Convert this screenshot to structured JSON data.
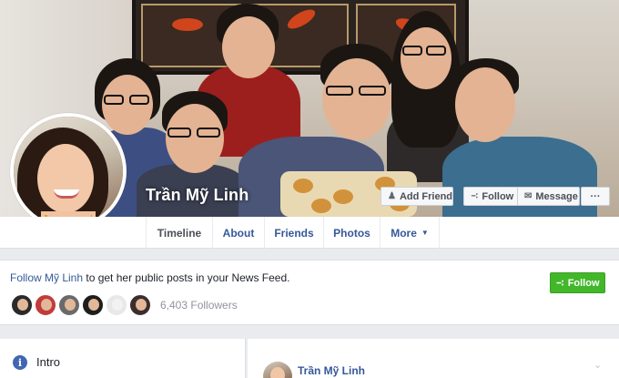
{
  "profile": {
    "name": "Trần Mỹ Linh"
  },
  "cover_actions": {
    "add_friend": "Add Friend",
    "follow": "Follow",
    "message": "Message",
    "more": "···"
  },
  "tabs": [
    {
      "label": "Timeline",
      "active": true
    },
    {
      "label": "About"
    },
    {
      "label": "Friends"
    },
    {
      "label": "Photos"
    },
    {
      "label": "More"
    }
  ],
  "follow_prompt": {
    "link_text": "Follow Mỹ Linh",
    "rest_text": " to get her public posts in your News Feed.",
    "button_label": "Follow",
    "followers_count": "6,403 Followers"
  },
  "intro": {
    "title": "Intro"
  },
  "post": {
    "author": "Trần Mỹ Linh"
  },
  "icons": {
    "add_friend": "add-person-icon",
    "follow": "rss-icon",
    "message": "chat-bubble-icon",
    "intro": "info-icon",
    "dropdown": "chevron-down-icon"
  },
  "colors": {
    "link": "#365899",
    "follow_green": "#42b72a",
    "page_bg": "#e9ebee"
  }
}
